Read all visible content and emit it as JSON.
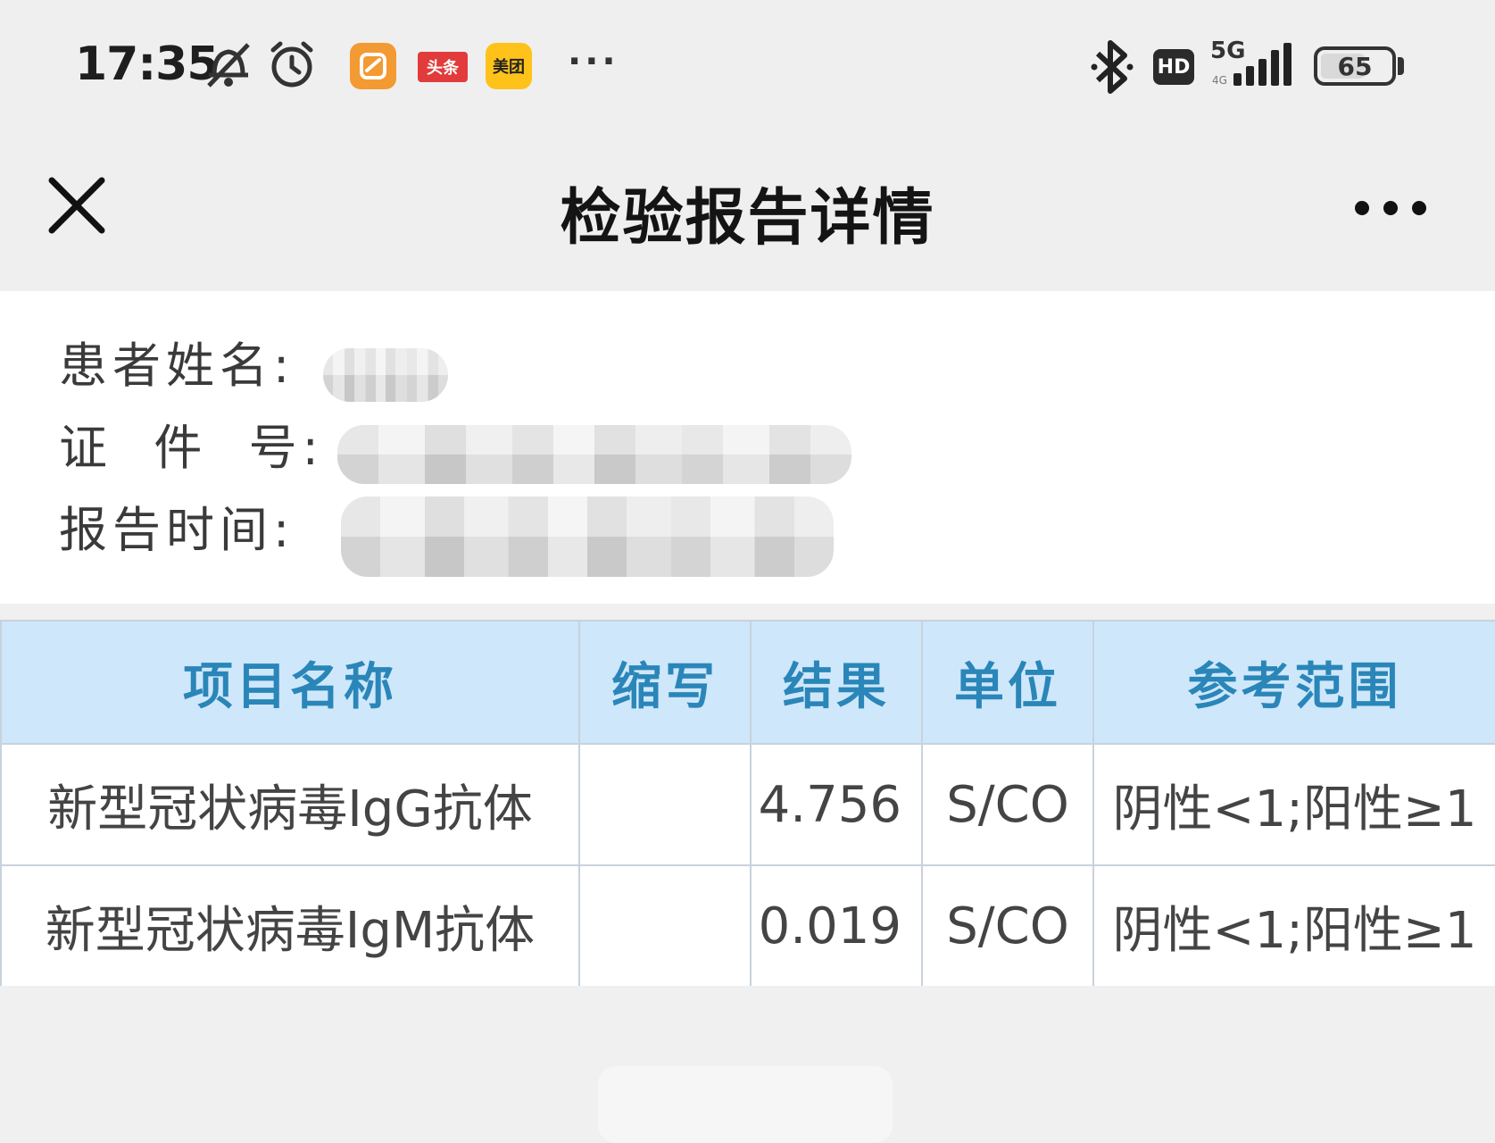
{
  "status_bar": {
    "time": "17:35",
    "app_icons": [
      {
        "name": "notification-muted-icon"
      },
      {
        "name": "alarm-icon"
      },
      {
        "name": "orange-app-icon",
        "color": "#f39a32"
      },
      {
        "name": "toutiao-app-icon",
        "label": "头条",
        "color": "#e23b3b"
      },
      {
        "name": "meituan-app-icon",
        "label": "美团",
        "color": "#ffc21a"
      }
    ],
    "more_dots": "···",
    "hd_label": "HD",
    "network": "5G",
    "battery_percent": 65
  },
  "nav": {
    "title": "检验报告详情",
    "close_icon": "close-icon",
    "more_icon": "more-dots-icon"
  },
  "patient": {
    "name_label": "患者姓名:",
    "id_label": "证  件  号:",
    "time_label": "报告时间:"
  },
  "table": {
    "headers": [
      "项目名称",
      "缩写",
      "结果",
      "单位",
      "参考范围"
    ],
    "rows": [
      {
        "item": "新型冠状病毒IgG抗体",
        "abbr": "",
        "result": "4.756",
        "unit": "S/CO",
        "range": "阴性<1;阳性≥1"
      },
      {
        "item": "新型冠状病毒IgM抗体",
        "abbr": "",
        "result": "0.019",
        "unit": "S/CO",
        "range": "阴性<1;阳性≥1"
      }
    ]
  },
  "colors": {
    "header_bg": "#cfe7fb",
    "header_text": "#2a86b8",
    "nav_bg": "#efefef"
  }
}
